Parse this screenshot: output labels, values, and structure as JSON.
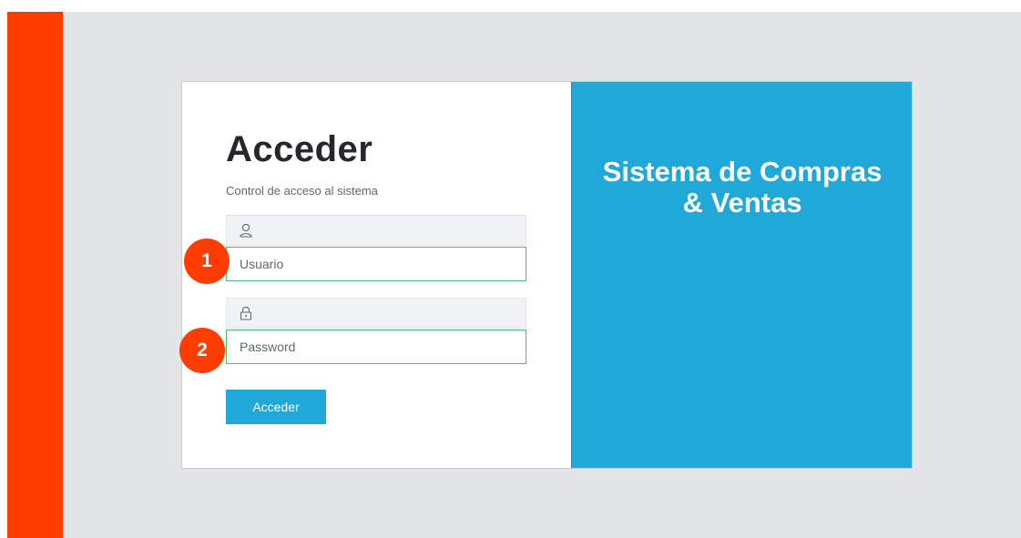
{
  "colors": {
    "accent_bar": "#ff3d00",
    "primary": "#20a8d8",
    "input_border": "#4dbd74",
    "background": "#e4e5e6"
  },
  "login": {
    "title": "Acceder",
    "subtitle": "Control de acceso al sistema",
    "username": {
      "icon": "user-icon",
      "placeholder": "Usuario",
      "value": ""
    },
    "password": {
      "icon": "lock-icon",
      "placeholder": "Password",
      "value": ""
    },
    "submit_label": "Acceder"
  },
  "brand": {
    "line1": "Sistema de Compras",
    "line2": "& Ventas"
  },
  "markers": [
    "1",
    "2"
  ]
}
